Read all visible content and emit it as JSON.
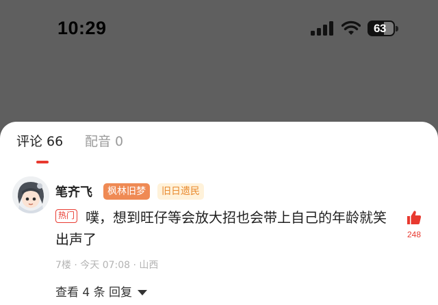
{
  "status_bar": {
    "time": "10:29",
    "battery": "63"
  },
  "tabs": [
    {
      "label": "评论 66"
    },
    {
      "label": "配音 0"
    }
  ],
  "comment": {
    "username": "笔齐飞",
    "badges": [
      "枫林旧梦",
      "旧日遗民"
    ],
    "hot_tag": "热门",
    "text": "噗，想到旺仔等会放大招也会带上自己的年龄就笑出声了",
    "likes": "248",
    "meta": "7楼 · 今天 07:08 · 山西",
    "view_replies": "查看 4 条 回复"
  },
  "colors": {
    "overlay": "#5f5f5f",
    "accent_red": "#e8392f",
    "badge_orange": "#ef8a54",
    "badge_light_bg": "#fff2da"
  }
}
